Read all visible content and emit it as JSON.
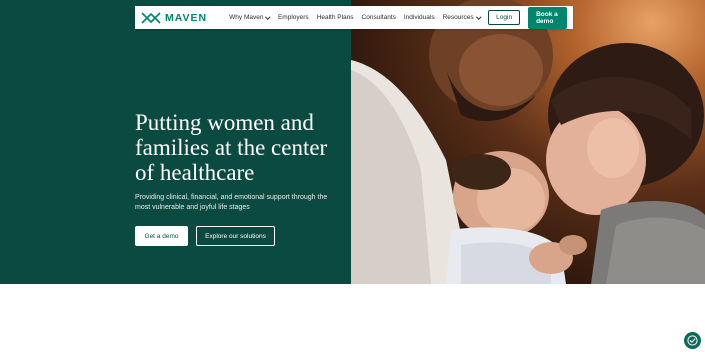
{
  "nav": {
    "logo_text": "MAVEN",
    "links": [
      {
        "label": "Why Maven",
        "dropdown": true
      },
      {
        "label": "Employers",
        "dropdown": false
      },
      {
        "label": "Health Plans",
        "dropdown": false
      },
      {
        "label": "Consultants",
        "dropdown": false
      },
      {
        "label": "Individuals",
        "dropdown": false
      },
      {
        "label": "Resources",
        "dropdown": true
      }
    ],
    "login_label": "Login",
    "book_label": "Book a demo"
  },
  "hero": {
    "headline": "Putting women and families at the center of healthcare",
    "subtext": "Providing clinical, financial, and emotional support through the most vulnerable and joyful life stages",
    "cta_primary": "Get a demo",
    "cta_secondary": "Explore our solutions",
    "photo_icon": "family-photo"
  },
  "floating": {
    "icon": "check-badge-icon"
  },
  "colors": {
    "brand_dark": "#0b4a40",
    "brand_accent": "#00856f",
    "white": "#ffffff"
  }
}
